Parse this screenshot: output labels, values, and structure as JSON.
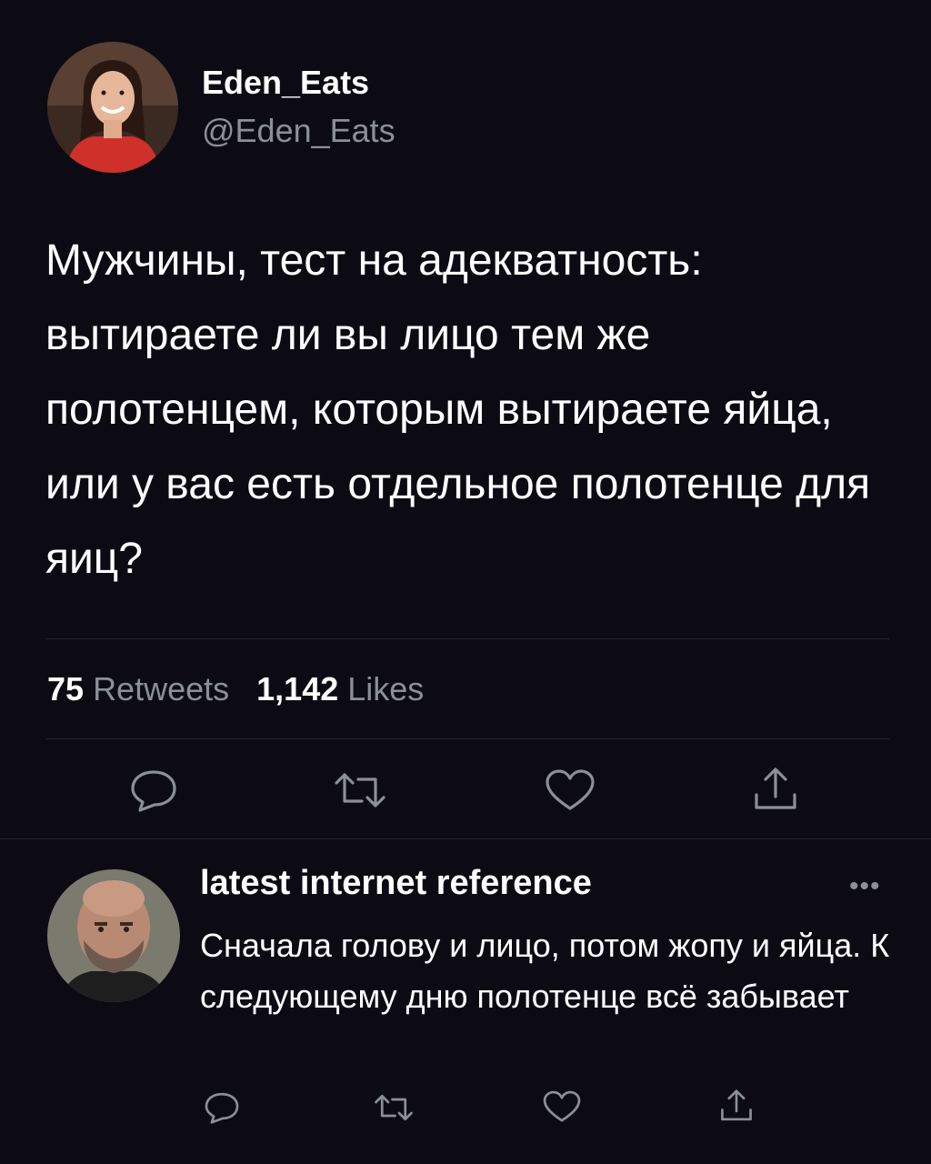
{
  "tweet": {
    "display_name": "Eden_Eats",
    "handle": "@Eden_Eats",
    "text": "Мужчины, тест на адекватность: вытираете ли вы лицо тем же полотенцем, которым вытираете яйца, или у вас есть отдельное полотенце для яиц?",
    "retweets_count": "75",
    "retweets_label": "Retweets",
    "likes_count": "1,142",
    "likes_label": "Likes",
    "actions": [
      "reply-icon",
      "retweet-icon",
      "heart-icon",
      "share-icon"
    ]
  },
  "reply": {
    "display_name": "latest internet reference",
    "more": "•••",
    "text": "Сначала голову и лицо, потом жопу и яйца. К следующему дню полотенце всё забывает",
    "actions": [
      "reply-icon",
      "retweet-icon",
      "heart-icon",
      "share-icon"
    ]
  },
  "colors": {
    "background": "#0c0b14",
    "text": "#ffffff",
    "secondary_text": "#8b8f97",
    "divider": "#24242e"
  }
}
